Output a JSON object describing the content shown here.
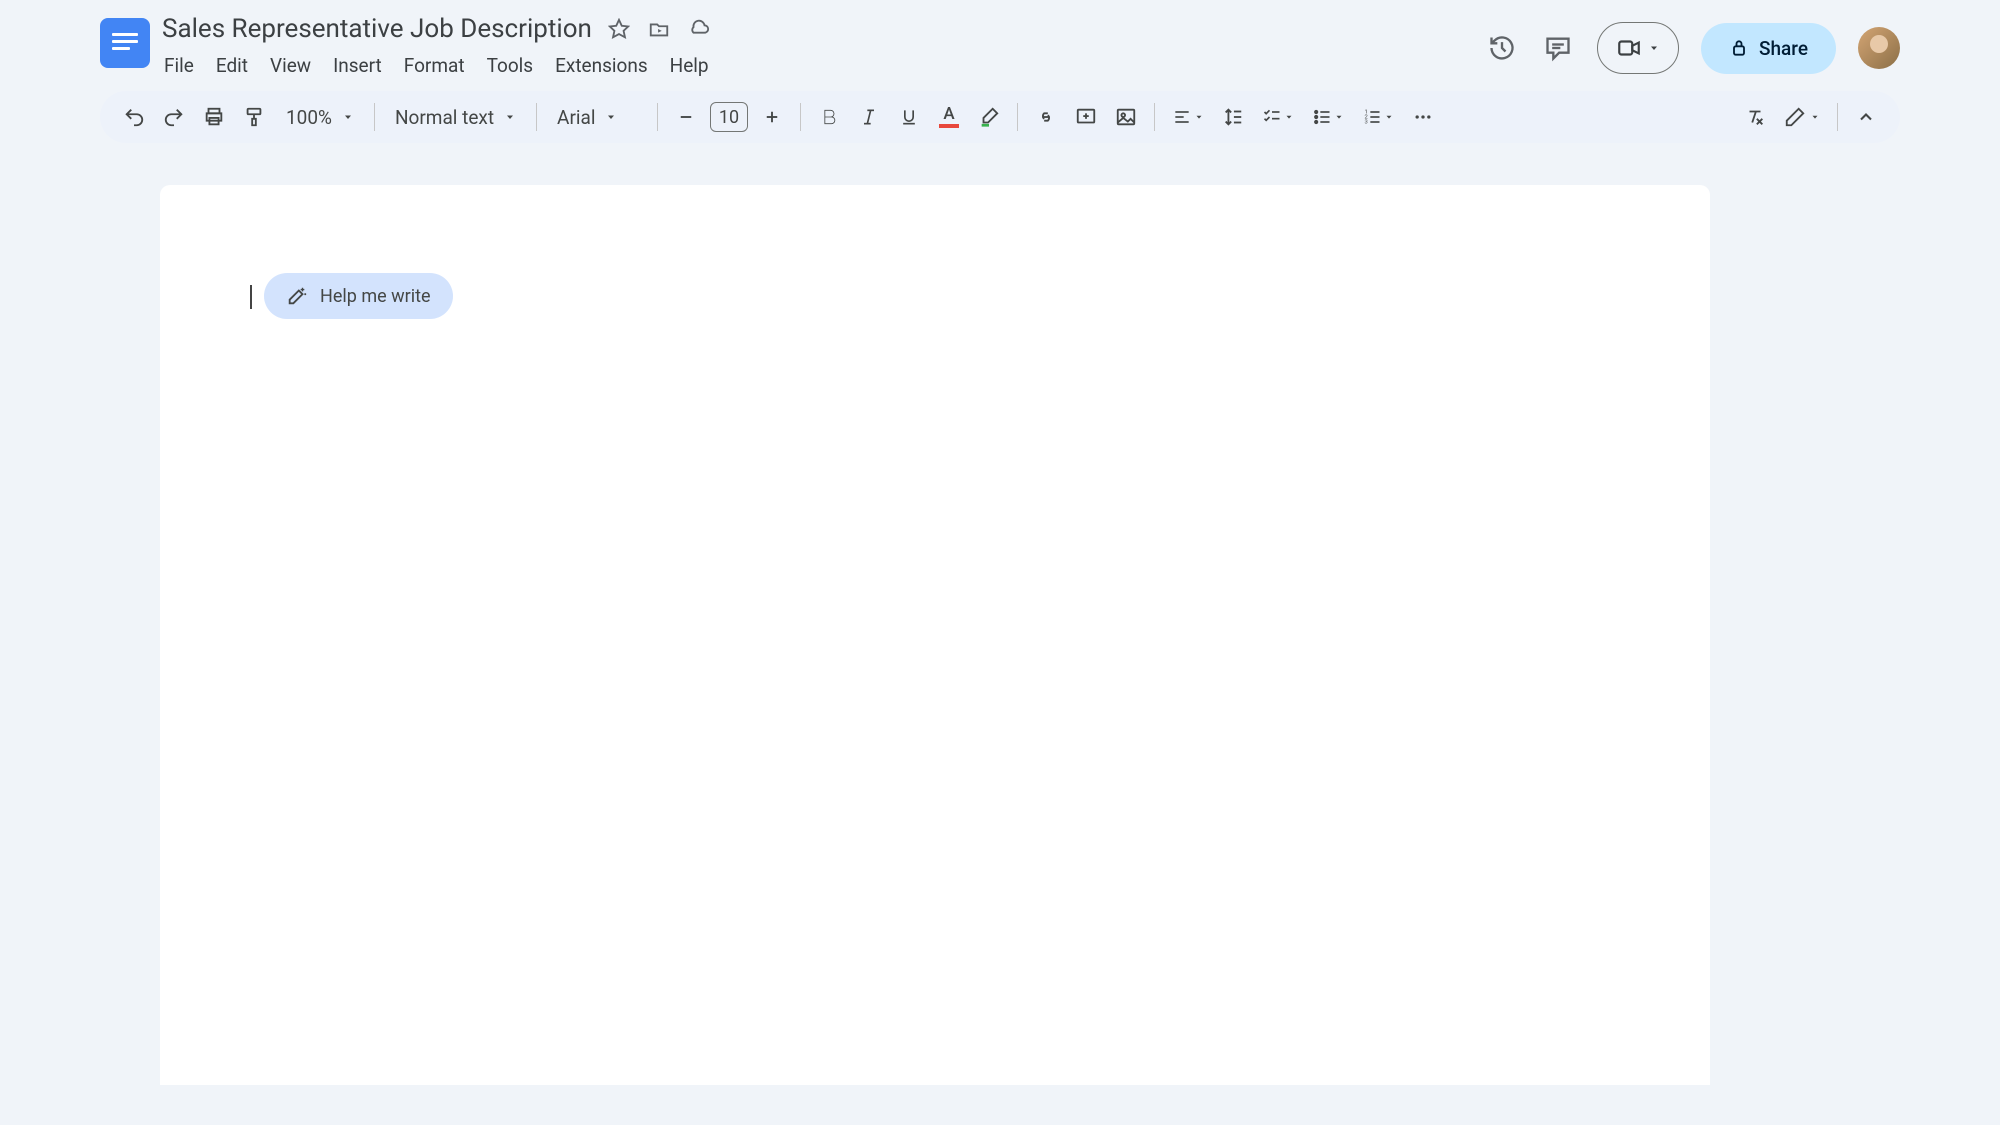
{
  "document": {
    "title": "Sales Representative Job Description"
  },
  "menus": {
    "file": "File",
    "edit": "Edit",
    "view": "View",
    "insert": "Insert",
    "format": "Format",
    "tools": "Tools",
    "extensions": "Extensions",
    "help": "Help"
  },
  "header": {
    "share_label": "Share"
  },
  "toolbar": {
    "zoom": "100%",
    "style": "Normal text",
    "font": "Arial",
    "font_size": "10"
  },
  "ai_chip": {
    "label": "Help me write"
  }
}
